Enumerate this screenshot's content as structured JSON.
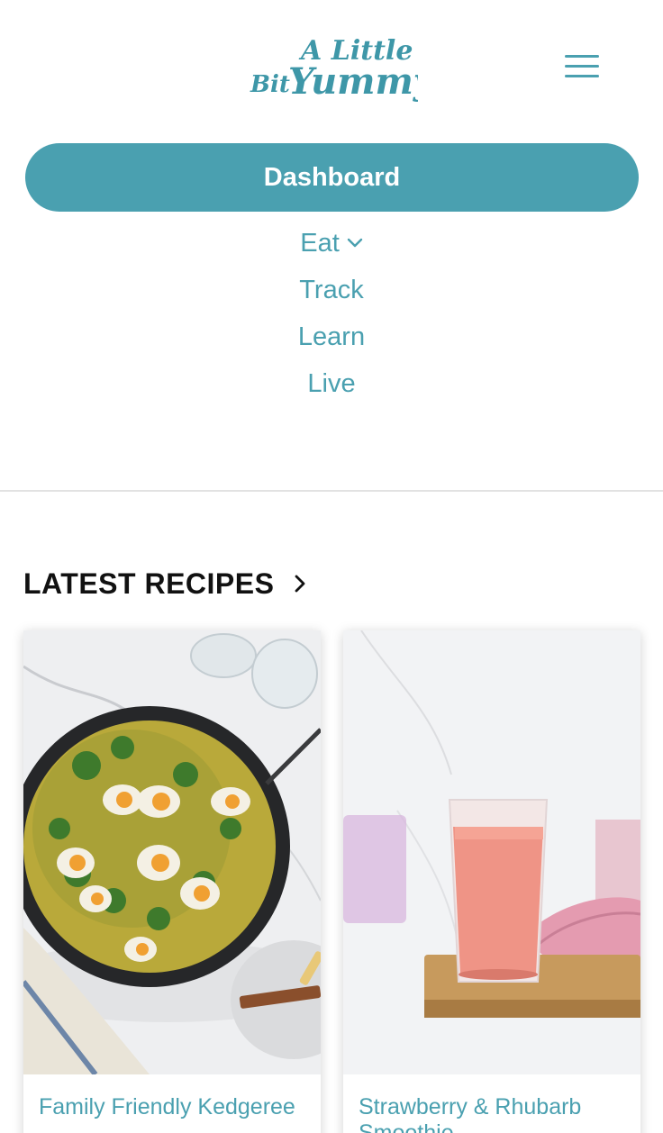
{
  "brand": {
    "logo_line1": "A Little",
    "logo_line2_a": "Bit",
    "logo_line2_b": "Yummy",
    "accent_color": "#4aa0b0"
  },
  "header": {
    "menu_icon": "hamburger-menu-icon"
  },
  "nav": {
    "dashboard_label": "Dashboard",
    "items": [
      {
        "label": "Eat",
        "icon": "chevron-down-icon"
      },
      {
        "label": "Track"
      },
      {
        "label": "Learn"
      },
      {
        "label": "Live"
      }
    ]
  },
  "latest": {
    "heading": "LATEST RECIPES",
    "heading_icon": "chevron-right-icon",
    "recipes": [
      {
        "title": "Family Friendly Kedgeree",
        "image": "kedgeree-photo"
      },
      {
        "title": "Strawberry & Rhubarb Smoothie",
        "image": "smoothie-photo"
      }
    ]
  }
}
